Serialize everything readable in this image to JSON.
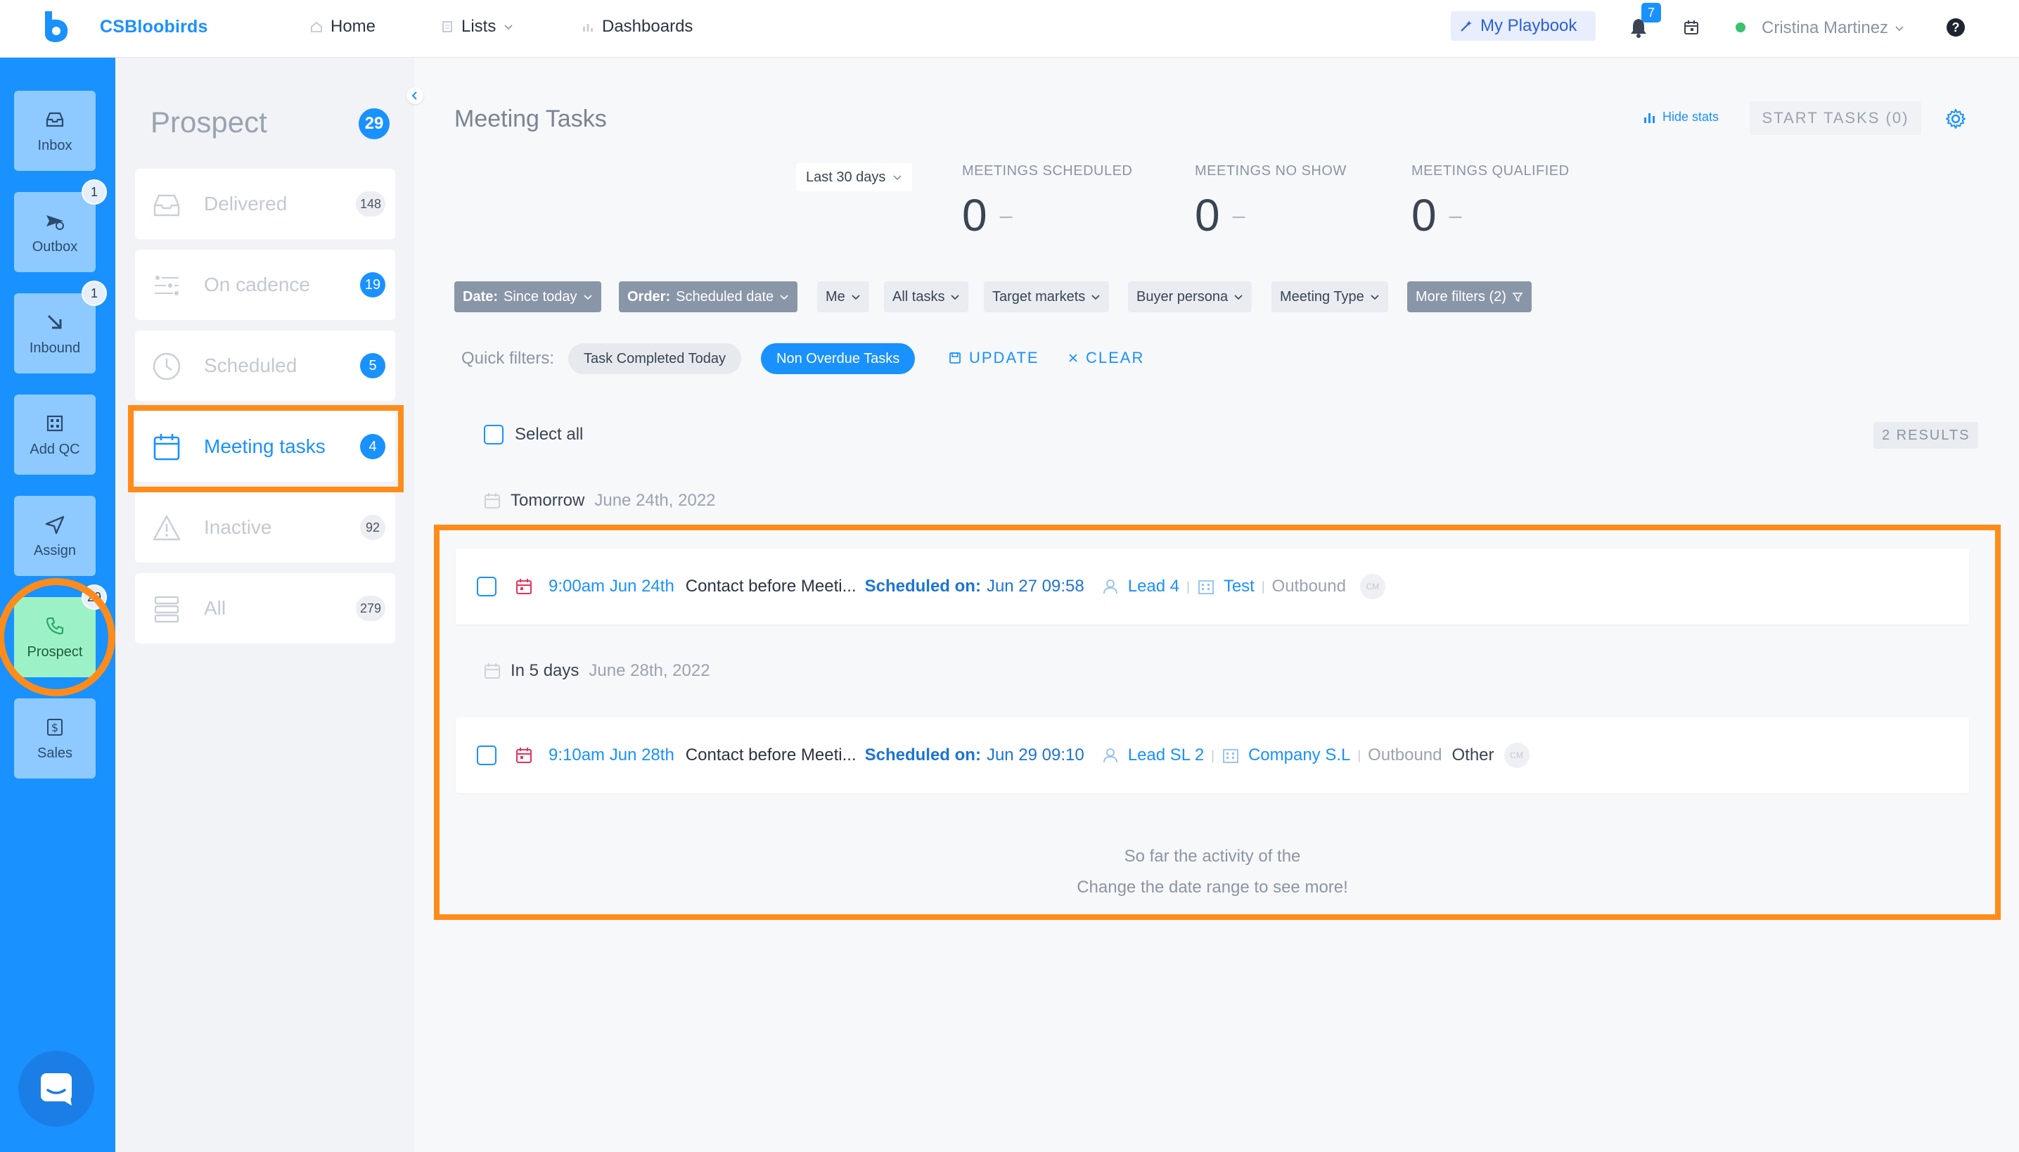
{
  "topbar": {
    "brand": "CSBloobirds",
    "nav": [
      {
        "label": "Home",
        "icon": "home-icon"
      },
      {
        "label": "Lists",
        "icon": "list-icon"
      },
      {
        "label": "Dashboards",
        "icon": "dashboard-icon"
      }
    ],
    "playbook_label": "My Playbook",
    "notifications_count": "7",
    "user_name": "Cristina Martinez",
    "help_label": "?"
  },
  "rail": {
    "items": [
      {
        "label": "Inbox",
        "icon": "inbox-icon",
        "badge": ""
      },
      {
        "label": "Outbox",
        "icon": "outbox-icon",
        "badge": "1"
      },
      {
        "label": "Inbound",
        "icon": "inbound-arrow-icon",
        "badge": "1"
      },
      {
        "label": "Add QC",
        "icon": "building-icon",
        "badge": ""
      },
      {
        "label": "Assign",
        "icon": "send-icon",
        "badge": ""
      },
      {
        "label": "Prospect",
        "icon": "phone-icon",
        "badge": "29"
      },
      {
        "label": "Sales",
        "icon": "dollar-icon",
        "badge": ""
      }
    ]
  },
  "subpanel": {
    "title": "Prospect",
    "count": "29",
    "items": [
      {
        "label": "Delivered",
        "count": "148",
        "icon": "inbox-tray-icon"
      },
      {
        "label": "On cadence",
        "count": "19",
        "icon": "cadence-icon"
      },
      {
        "label": "Scheduled",
        "count": "5",
        "icon": "clock-icon"
      },
      {
        "label": "Meeting tasks",
        "count": "4",
        "icon": "calendar-icon"
      },
      {
        "label": "Inactive",
        "count": "92",
        "icon": "warning-icon"
      },
      {
        "label": "All",
        "count": "279",
        "icon": "stack-icon"
      }
    ]
  },
  "main": {
    "title": "Meeting Tasks",
    "hide_stats": "Hide stats",
    "start_tasks": "START TASKS (0)",
    "range": "Last 30 days",
    "stats": [
      {
        "label": "MEETINGS SCHEDULED",
        "value": "0",
        "trend": "–"
      },
      {
        "label": "MEETINGS NO SHOW",
        "value": "0",
        "trend": "–"
      },
      {
        "label": "MEETINGS QUALIFIED",
        "value": "0",
        "trend": "–"
      }
    ],
    "filters": {
      "date_key": "Date:",
      "date_val": "Since today",
      "order_key": "Order:",
      "order_val": "Scheduled date",
      "me": "Me",
      "all_tasks": "All tasks",
      "target_markets": "Target markets",
      "buyer_persona": "Buyer persona",
      "meeting_type": "Meeting Type",
      "more_filters": "More filters (2)"
    },
    "quick_filters": {
      "label": "Quick filters:",
      "chip1": "Task Completed Today",
      "chip2": "Non Overdue Tasks",
      "update": "UPDATE",
      "clear": "CLEAR"
    },
    "select_all": "Select all",
    "results": "2 RESULTS",
    "groups": [
      {
        "day": "Tomorrow",
        "date": "June 24th, 2022",
        "task": {
          "time": "9:00am Jun 24th",
          "title": "Contact before Meeti...",
          "sched_label": "Scheduled on:",
          "sched_value": "Jun 27 09:58",
          "lead": "Lead 4",
          "company": "Test",
          "source": "Outbound",
          "extra": "",
          "avatar": "CM"
        }
      },
      {
        "day": "In 5 days",
        "date": "June 28th, 2022",
        "task": {
          "time": "9:10am Jun 28th",
          "title": "Contact before Meeti...",
          "sched_label": "Scheduled on:",
          "sched_value": "Jun 29 09:10",
          "lead": "Lead SL 2",
          "company": "Company S.L",
          "source": "Outbound",
          "extra": "Other",
          "avatar": "CM"
        }
      }
    ],
    "footer_line1": "So far the activity of the",
    "footer_line2": "Change the date range to see more!"
  },
  "colors": {
    "accent": "#1991ff",
    "highlight": "#ff8c1a",
    "active_green": "#9cf2c6"
  }
}
